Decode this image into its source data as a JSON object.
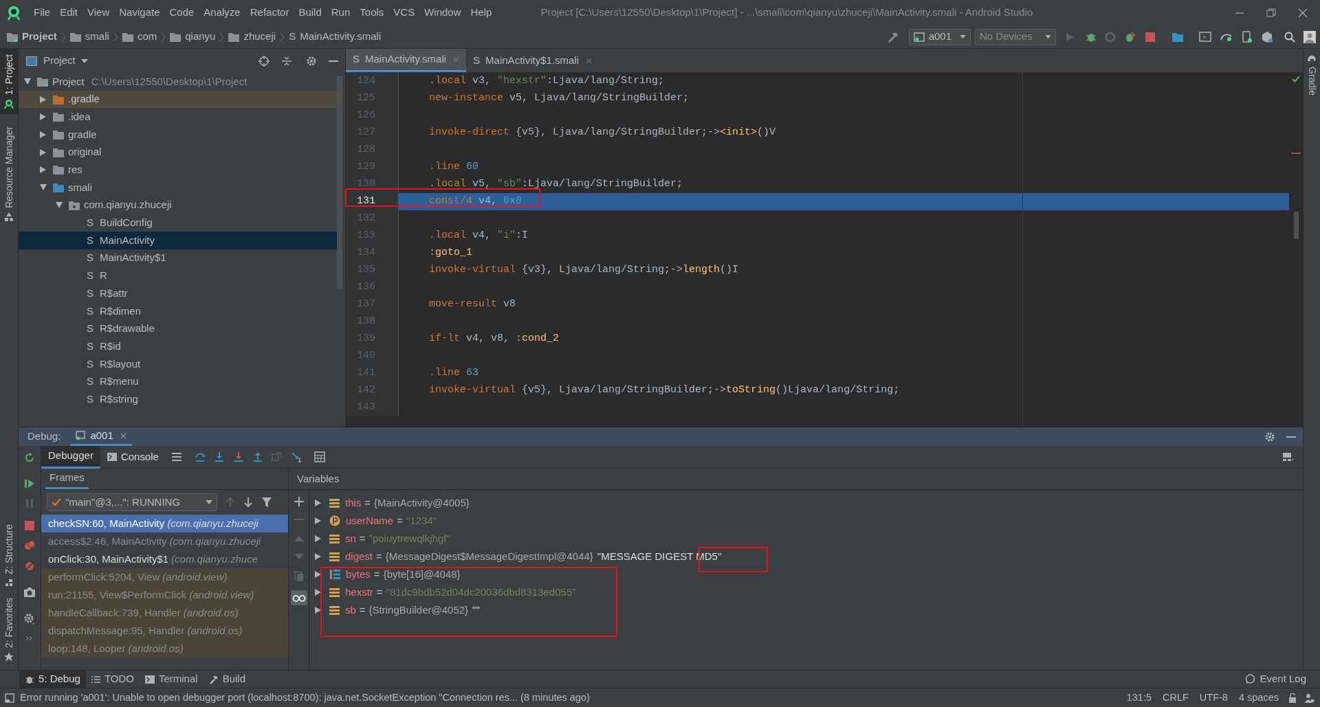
{
  "menu": [
    {
      "label": "File"
    },
    {
      "label": "Edit"
    },
    {
      "label": "View"
    },
    {
      "label": "Navigate"
    },
    {
      "label": "Code"
    },
    {
      "label": "Analyze"
    },
    {
      "label": "Refactor"
    },
    {
      "label": "Build"
    },
    {
      "label": "Run"
    },
    {
      "label": "Tools"
    },
    {
      "label": "VCS"
    },
    {
      "label": "Window"
    },
    {
      "label": "Help"
    }
  ],
  "window": {
    "title": "Project [C:\\Users\\12550\\Desktop\\1\\Project] - ...\\smali\\com\\qianyu\\zhuceji\\MainActivity.smali - Android Studio"
  },
  "breadcrumbs": [
    {
      "label": "Project",
      "kind": "project"
    },
    {
      "label": "smali",
      "kind": "folder"
    },
    {
      "label": "com",
      "kind": "folder"
    },
    {
      "label": "qianyu",
      "kind": "folder"
    },
    {
      "label": "zhuceji",
      "kind": "folder"
    },
    {
      "label": "MainActivity.smali",
      "kind": "file",
      "glyph": "S"
    }
  ],
  "toolbar": {
    "run_config": "a001",
    "device": "No Devices"
  },
  "left_strip": {
    "top": [
      {
        "label": "1: Project",
        "selected": true
      },
      {
        "label": "Resource Manager",
        "selected": false
      }
    ],
    "bottom": [
      {
        "label": "Z: Structure",
        "selected": false
      },
      {
        "label": "2: Favorites",
        "selected": false
      }
    ]
  },
  "right_strip": [
    {
      "label": "Gradle",
      "selected": false
    }
  ],
  "project_panel": {
    "title": "Project"
  },
  "project_tree": [
    {
      "label": "Project",
      "path": "C:\\Users\\12550\\Desktop\\1\\Project",
      "kind": "project",
      "expanded": true,
      "selected": false,
      "children": [
        {
          "label": ".gradle",
          "kind": "excluded",
          "expanded": false,
          "selected": false
        },
        {
          "label": ".idea",
          "kind": "folder",
          "expanded": false,
          "selected": false
        },
        {
          "label": "gradle",
          "kind": "folder",
          "expanded": false,
          "selected": false
        },
        {
          "label": "original",
          "kind": "folder",
          "expanded": false,
          "selected": false
        },
        {
          "label": "res",
          "kind": "folder",
          "expanded": false,
          "selected": false
        },
        {
          "label": "smali",
          "kind": "source",
          "expanded": true,
          "selected": false,
          "children": [
            {
              "label": "com.qianyu.zhuceji",
              "kind": "package",
              "expanded": true,
              "selected": false,
              "children": [
                {
                  "label": "BuildConfig",
                  "kind": "file",
                  "glyph": "S",
                  "selected": false
                },
                {
                  "label": "MainActivity",
                  "kind": "file",
                  "glyph": "S",
                  "selected": true
                },
                {
                  "label": "MainActivity$1",
                  "kind": "file",
                  "glyph": "S",
                  "selected": false
                },
                {
                  "label": "R",
                  "kind": "file",
                  "glyph": "S",
                  "selected": false
                },
                {
                  "label": "R$attr",
                  "kind": "file",
                  "glyph": "S",
                  "selected": false
                },
                {
                  "label": "R$dimen",
                  "kind": "file",
                  "glyph": "S",
                  "selected": false
                },
                {
                  "label": "R$drawable",
                  "kind": "file",
                  "glyph": "S",
                  "selected": false
                },
                {
                  "label": "R$id",
                  "kind": "file",
                  "glyph": "S",
                  "selected": false
                },
                {
                  "label": "R$layout",
                  "kind": "file",
                  "glyph": "S",
                  "selected": false
                },
                {
                  "label": "R$menu",
                  "kind": "file",
                  "glyph": "S",
                  "selected": false
                },
                {
                  "label": "R$string",
                  "kind": "file",
                  "glyph": "S",
                  "selected": false
                }
              ]
            }
          ]
        }
      ]
    }
  ],
  "editor_tabs": [
    {
      "label": "MainActivity.smali",
      "glyph": "S",
      "selected": true
    },
    {
      "label": "MainActivity$1.smali",
      "glyph": "S",
      "selected": false
    }
  ],
  "code": [
    {
      "number": "124",
      "current": false,
      "segments": [
        {
          "kind": "keyword",
          "text": ".local"
        },
        {
          "kind": "plain",
          "text": " v3, "
        },
        {
          "kind": "string",
          "text": "\"hexstr\""
        },
        {
          "kind": "plain",
          "text": ":Ljava/lang/String;"
        }
      ]
    },
    {
      "number": "125",
      "current": false,
      "segments": [
        {
          "kind": "keyword",
          "text": "new-instance"
        },
        {
          "kind": "plain",
          "text": " v5, Ljava/lang/StringBuilder;"
        }
      ]
    },
    {
      "number": "126",
      "current": false
    },
    {
      "number": "127",
      "current": false,
      "segments": [
        {
          "kind": "keyword",
          "text": "invoke-direct"
        },
        {
          "kind": "plain",
          "text": " {v5}, Ljava/lang/StringBuilder;->"
        },
        {
          "kind": "method",
          "text": "<init>"
        },
        {
          "kind": "plain",
          "text": "()V"
        }
      ]
    },
    {
      "number": "128",
      "current": false
    },
    {
      "number": "129",
      "current": false,
      "segments": [
        {
          "kind": "keyword",
          "text": ".line"
        },
        {
          "kind": "number",
          "text": " 60"
        }
      ]
    },
    {
      "number": "130",
      "current": false,
      "segments": [
        {
          "kind": "keyword",
          "text": ".local"
        },
        {
          "kind": "plain",
          "text": " v5, "
        },
        {
          "kind": "string",
          "text": "\"sb\""
        },
        {
          "kind": "plain",
          "text": ":Ljava/lang/StringBuilder;"
        }
      ]
    },
    {
      "number": "131",
      "current": true,
      "segments": [
        {
          "kind": "keyword",
          "text": "const/4"
        },
        {
          "kind": "plain",
          "text": " v4, "
        },
        {
          "kind": "number",
          "text": "0x0"
        }
      ]
    },
    {
      "number": "132",
      "current": false
    },
    {
      "number": "133",
      "current": false,
      "segments": [
        {
          "kind": "keyword",
          "text": ".local"
        },
        {
          "kind": "plain",
          "text": " v4, "
        },
        {
          "kind": "string",
          "text": "\"i\""
        },
        {
          "kind": "plain",
          "text": ":I"
        }
      ]
    },
    {
      "number": "134",
      "current": false,
      "segments": [
        {
          "kind": "plain",
          "text": ":"
        },
        {
          "kind": "method",
          "text": "goto_1"
        }
      ]
    },
    {
      "number": "135",
      "current": false,
      "segments": [
        {
          "kind": "keyword",
          "text": "invoke-virtual"
        },
        {
          "kind": "plain",
          "text": " {v3}, Ljava/lang/String;->"
        },
        {
          "kind": "method",
          "text": "length"
        },
        {
          "kind": "plain",
          "text": "()I"
        }
      ]
    },
    {
      "number": "136",
      "current": false
    },
    {
      "number": "137",
      "current": false,
      "segments": [
        {
          "kind": "keyword",
          "text": "move-result"
        },
        {
          "kind": "plain",
          "text": " v8"
        }
      ]
    },
    {
      "number": "138",
      "current": false
    },
    {
      "number": "139",
      "current": false,
      "segments": [
        {
          "kind": "keyword",
          "text": "if-lt"
        },
        {
          "kind": "plain",
          "text": " v4, v8, :"
        },
        {
          "kind": "method",
          "text": "cond_2"
        }
      ]
    },
    {
      "number": "140",
      "current": false
    },
    {
      "number": "141",
      "current": false,
      "segments": [
        {
          "kind": "keyword",
          "text": ".line"
        },
        {
          "kind": "number",
          "text": " 63"
        }
      ]
    },
    {
      "number": "142",
      "current": false,
      "segments": [
        {
          "kind": "keyword",
          "text": "invoke-virtual"
        },
        {
          "kind": "plain",
          "text": " {v5}, Ljava/lang/StringBuilder;->"
        },
        {
          "kind": "method",
          "text": "toString"
        },
        {
          "kind": "plain",
          "text": "()Ljava/lang/String;"
        }
      ]
    },
    {
      "number": "143",
      "current": false
    }
  ],
  "debug": {
    "label": "Debug:",
    "session": {
      "label": "a001",
      "selected": true
    },
    "tabs": [
      {
        "label": "Debugger",
        "selected": true
      },
      {
        "label": "Console",
        "selected": false
      }
    ],
    "frames_title": "Frames",
    "variables_title": "Variables",
    "thread": "\"main\"@3,...\": RUNNING",
    "frames": [
      {
        "method": "checkSN:60, MainActivity",
        "package": "(com.qianyu.zhuceji",
        "kind": "app",
        "selected": true
      },
      {
        "method": "access$2:46, MainActivity",
        "package": "(com.qianyu.zhuceji",
        "kind": "synthetic",
        "selected": false
      },
      {
        "method": "onClick:30, MainActivity$1",
        "package": "(com.qianyu.zhuce",
        "kind": "app",
        "selected": false
      },
      {
        "method": "performClick:5204, View",
        "package": "(android.view)",
        "kind": "library",
        "selected": false
      },
      {
        "method": "run:21155, View$PerformClick",
        "package": "(android.view)",
        "kind": "library",
        "selected": false
      },
      {
        "method": "handleCallback:739, Handler",
        "package": "(android.os)",
        "kind": "library",
        "selected": false
      },
      {
        "method": "dispatchMessage:95, Handler",
        "package": "(android.os)",
        "kind": "library",
        "selected": false
      },
      {
        "method": "loop:148, Looper",
        "package": "(android.os)",
        "kind": "library",
        "selected": false
      }
    ],
    "variables": [
      {
        "kind": "field",
        "name": "this",
        "separator": "=",
        "ref": "{MainActivity@4005}",
        "expanded": false
      },
      {
        "kind": "primitive",
        "name": "userName",
        "separator": "=",
        "value": "\"1234\"",
        "expanded": false
      },
      {
        "kind": "field",
        "name": "sn",
        "separator": "=",
        "value": "\"poiuytrewqlkjhgf\"",
        "expanded": false
      },
      {
        "kind": "field",
        "name": "digest",
        "separator": "=",
        "ref": "{MessageDigest$MessageDigestImpl@4044}",
        "rendered": "\"MESSAGE DIGEST MD5\"",
        "expanded": false
      },
      {
        "kind": "array",
        "name": "bytes",
        "separator": "=",
        "ref": "{byte[16]@4048}",
        "expanded": false
      },
      {
        "kind": "field",
        "name": "hexstr",
        "separator": "=",
        "value": "\"81dc9bdb52d04dc20036dbd8313ed055\"",
        "expanded": false
      },
      {
        "kind": "field",
        "name": "sb",
        "separator": "=",
        "ref": "{StringBuilder@4052}",
        "rendered": "\"\"",
        "expanded": false
      }
    ]
  },
  "tool_tabs": [
    {
      "label": "5: Debug",
      "selected": true
    },
    {
      "label": "TODO",
      "selected": false
    },
    {
      "label": "Terminal",
      "selected": false
    },
    {
      "label": "Build",
      "selected": false
    }
  ],
  "event_log": "Event Log",
  "status": {
    "message": "Error running 'a001': Unable to open debugger port (localhost:8700): java.net.SocketException \"Connection res... (8 minutes ago)",
    "position": "131:5",
    "line_separator": "CRLF",
    "encoding": "UTF-8",
    "indent": "4 spaces"
  }
}
